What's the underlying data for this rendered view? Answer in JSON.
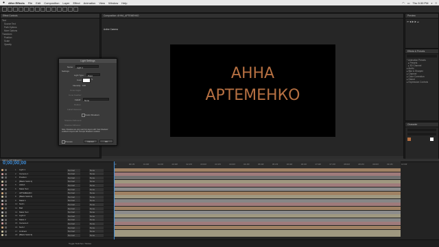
{
  "menubar": {
    "app": "After Effects",
    "items": [
      "File",
      "Edit",
      "Composition",
      "Layer",
      "Effect",
      "Animation",
      "View",
      "Window",
      "Help"
    ],
    "clock": "Thu 5:30 PM"
  },
  "comp": {
    "tab_label": "Composition: АННА_АРТЕМЕНКО",
    "camera_label": "Active Camera",
    "text_line1": "АННА",
    "text_line2": "АРТЕМЕНКО"
  },
  "dialog": {
    "title": "Light Settings",
    "name_label": "Name:",
    "name_value": "Light 1",
    "settings_label": "Settings",
    "light_type_label": "Light Type:",
    "light_type_value": "Point",
    "color_label": "Color:",
    "intensity_label": "Intensity:",
    "intensity_value": "100",
    "cone_angle_label": "Cone Angle:",
    "cone_feather_label": "Cone Feather:",
    "falloff_label": "Falloff:",
    "falloff_value": "None",
    "radius_label": "Radius:",
    "falloff_distance_label": "Falloff Distance:",
    "casts_shadows_label": "Casts Shadows",
    "shadow_darkness_label": "Shadow Darkness:",
    "shadow_diffusion_label": "Shadow Diffusion:",
    "note": "Note: Shadows are only cast from layers with 'Cast Shadows' enabled to layers with 'Accepts Shadows' enabled.",
    "preview_label": "Preview",
    "cancel": "Cancel",
    "ok": "OK"
  },
  "effects_panel": {
    "title": "Effect Controls",
    "rows": [
      "Text",
      "Source Text",
      "Path Options",
      "More Options",
      "Transform",
      "Position",
      "Scale",
      "Opacity"
    ]
  },
  "right": {
    "preview_title": "Preview",
    "effects_title": "Effects & Presets",
    "effects_rows": [
      "* Animation Presets",
      "▸ Presets",
      "▸ 3D Channel",
      "▸ Audio",
      "▸ Blur & Sharpen",
      "▸ Channel",
      "▸ Color Correction",
      "▸ Distort",
      "▸ Expression Controls"
    ],
    "char_title": "Character"
  },
  "timeline": {
    "timecode": "0;00;00;00",
    "tab_label": "АННА_АРТЕМЕНКО",
    "ruler": [
      "0f",
      "00:15f",
      "01:00f",
      "01:15f",
      "02:00f",
      "02:15f",
      "03:00f",
      "03:15f",
      "04:00f",
      "04:15f",
      "05:00f",
      "05:15f",
      "06:00f",
      "06:15f",
      "07:00f",
      "07:15f",
      "08:00f",
      "08:15f",
      "09:00f",
      "09:15f",
      "10:00f"
    ],
    "layers": [
      {
        "num": "1",
        "name": "Light 1",
        "color": "#c9a27a"
      },
      {
        "num": "2",
        "name": "Camera 1",
        "color": "#c99a9a"
      },
      {
        "num": "3",
        "name": "Position",
        "color": "#8a8a8a"
      },
      {
        "num": "4",
        "name": "[Black Solid 1]",
        "color": "#c9c0a0"
      },
      {
        "num": "5",
        "name": "АННА",
        "color": "#c99a9a"
      },
      {
        "num": "6",
        "name": "Mask Text",
        "color": "#b0b0b0"
      },
      {
        "num": "7",
        "name": "АРТЕМЕНКО",
        "color": "#c9a27a"
      },
      {
        "num": "8",
        "name": "[Black Solid 2]",
        "color": "#c9c0a0"
      },
      {
        "num": "9",
        "name": "Mask 1",
        "color": "#a8a8a8"
      },
      {
        "num": "10",
        "name": "Null 1",
        "color": "#c99a9a"
      },
      {
        "num": "11",
        "name": "Ball",
        "color": "#c9a27a"
      },
      {
        "num": "12",
        "name": "Mask Text",
        "color": "#b0b0b0"
      },
      {
        "num": "13",
        "name": "Light 2",
        "color": "#c9c0a0"
      },
      {
        "num": "14",
        "name": "Mask 2",
        "color": "#a8a8a8"
      },
      {
        "num": "15",
        "name": "Camera 2",
        "color": "#c99a9a"
      },
      {
        "num": "16",
        "name": "Null 2",
        "color": "#c9a27a"
      },
      {
        "num": "17",
        "name": "Ambient",
        "color": "#c9c0a0"
      },
      {
        "num": "18",
        "name": "[Black Solid 3]",
        "color": "#c9c0a0"
      }
    ],
    "mode_label": "Normal",
    "parent_label": "None",
    "bottom_label": "Toggle Switches / Modes"
  }
}
